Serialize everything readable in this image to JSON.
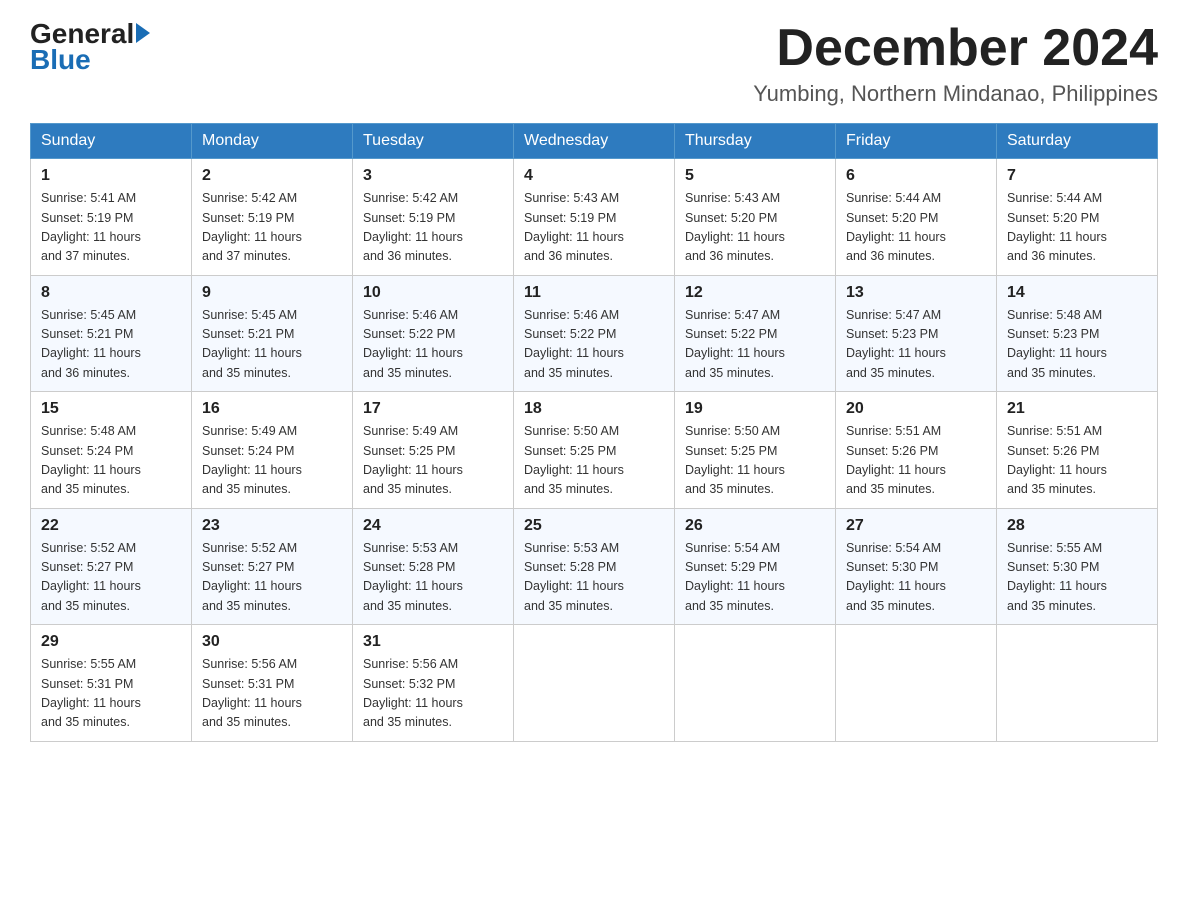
{
  "logo": {
    "text_general": "General",
    "text_blue": "Blue",
    "arrow_color": "#1a6db5"
  },
  "header": {
    "month_year": "December 2024",
    "location": "Yumbing, Northern Mindanao, Philippines"
  },
  "weekdays": [
    "Sunday",
    "Monday",
    "Tuesday",
    "Wednesday",
    "Thursday",
    "Friday",
    "Saturday"
  ],
  "weeks": [
    [
      {
        "day": "1",
        "sunrise": "5:41 AM",
        "sunset": "5:19 PM",
        "daylight": "11 hours and 37 minutes."
      },
      {
        "day": "2",
        "sunrise": "5:42 AM",
        "sunset": "5:19 PM",
        "daylight": "11 hours and 37 minutes."
      },
      {
        "day": "3",
        "sunrise": "5:42 AM",
        "sunset": "5:19 PM",
        "daylight": "11 hours and 36 minutes."
      },
      {
        "day": "4",
        "sunrise": "5:43 AM",
        "sunset": "5:19 PM",
        "daylight": "11 hours and 36 minutes."
      },
      {
        "day": "5",
        "sunrise": "5:43 AM",
        "sunset": "5:20 PM",
        "daylight": "11 hours and 36 minutes."
      },
      {
        "day": "6",
        "sunrise": "5:44 AM",
        "sunset": "5:20 PM",
        "daylight": "11 hours and 36 minutes."
      },
      {
        "day": "7",
        "sunrise": "5:44 AM",
        "sunset": "5:20 PM",
        "daylight": "11 hours and 36 minutes."
      }
    ],
    [
      {
        "day": "8",
        "sunrise": "5:45 AM",
        "sunset": "5:21 PM",
        "daylight": "11 hours and 36 minutes."
      },
      {
        "day": "9",
        "sunrise": "5:45 AM",
        "sunset": "5:21 PM",
        "daylight": "11 hours and 35 minutes."
      },
      {
        "day": "10",
        "sunrise": "5:46 AM",
        "sunset": "5:22 PM",
        "daylight": "11 hours and 35 minutes."
      },
      {
        "day": "11",
        "sunrise": "5:46 AM",
        "sunset": "5:22 PM",
        "daylight": "11 hours and 35 minutes."
      },
      {
        "day": "12",
        "sunrise": "5:47 AM",
        "sunset": "5:22 PM",
        "daylight": "11 hours and 35 minutes."
      },
      {
        "day": "13",
        "sunrise": "5:47 AM",
        "sunset": "5:23 PM",
        "daylight": "11 hours and 35 minutes."
      },
      {
        "day": "14",
        "sunrise": "5:48 AM",
        "sunset": "5:23 PM",
        "daylight": "11 hours and 35 minutes."
      }
    ],
    [
      {
        "day": "15",
        "sunrise": "5:48 AM",
        "sunset": "5:24 PM",
        "daylight": "11 hours and 35 minutes."
      },
      {
        "day": "16",
        "sunrise": "5:49 AM",
        "sunset": "5:24 PM",
        "daylight": "11 hours and 35 minutes."
      },
      {
        "day": "17",
        "sunrise": "5:49 AM",
        "sunset": "5:25 PM",
        "daylight": "11 hours and 35 minutes."
      },
      {
        "day": "18",
        "sunrise": "5:50 AM",
        "sunset": "5:25 PM",
        "daylight": "11 hours and 35 minutes."
      },
      {
        "day": "19",
        "sunrise": "5:50 AM",
        "sunset": "5:25 PM",
        "daylight": "11 hours and 35 minutes."
      },
      {
        "day": "20",
        "sunrise": "5:51 AM",
        "sunset": "5:26 PM",
        "daylight": "11 hours and 35 minutes."
      },
      {
        "day": "21",
        "sunrise": "5:51 AM",
        "sunset": "5:26 PM",
        "daylight": "11 hours and 35 minutes."
      }
    ],
    [
      {
        "day": "22",
        "sunrise": "5:52 AM",
        "sunset": "5:27 PM",
        "daylight": "11 hours and 35 minutes."
      },
      {
        "day": "23",
        "sunrise": "5:52 AM",
        "sunset": "5:27 PM",
        "daylight": "11 hours and 35 minutes."
      },
      {
        "day": "24",
        "sunrise": "5:53 AM",
        "sunset": "5:28 PM",
        "daylight": "11 hours and 35 minutes."
      },
      {
        "day": "25",
        "sunrise": "5:53 AM",
        "sunset": "5:28 PM",
        "daylight": "11 hours and 35 minutes."
      },
      {
        "day": "26",
        "sunrise": "5:54 AM",
        "sunset": "5:29 PM",
        "daylight": "11 hours and 35 minutes."
      },
      {
        "day": "27",
        "sunrise": "5:54 AM",
        "sunset": "5:30 PM",
        "daylight": "11 hours and 35 minutes."
      },
      {
        "day": "28",
        "sunrise": "5:55 AM",
        "sunset": "5:30 PM",
        "daylight": "11 hours and 35 minutes."
      }
    ],
    [
      {
        "day": "29",
        "sunrise": "5:55 AM",
        "sunset": "5:31 PM",
        "daylight": "11 hours and 35 minutes."
      },
      {
        "day": "30",
        "sunrise": "5:56 AM",
        "sunset": "5:31 PM",
        "daylight": "11 hours and 35 minutes."
      },
      {
        "day": "31",
        "sunrise": "5:56 AM",
        "sunset": "5:32 PM",
        "daylight": "11 hours and 35 minutes."
      },
      null,
      null,
      null,
      null
    ]
  ],
  "cell_labels": {
    "sunrise": "Sunrise: ",
    "sunset": "Sunset: ",
    "daylight": "Daylight: "
  }
}
